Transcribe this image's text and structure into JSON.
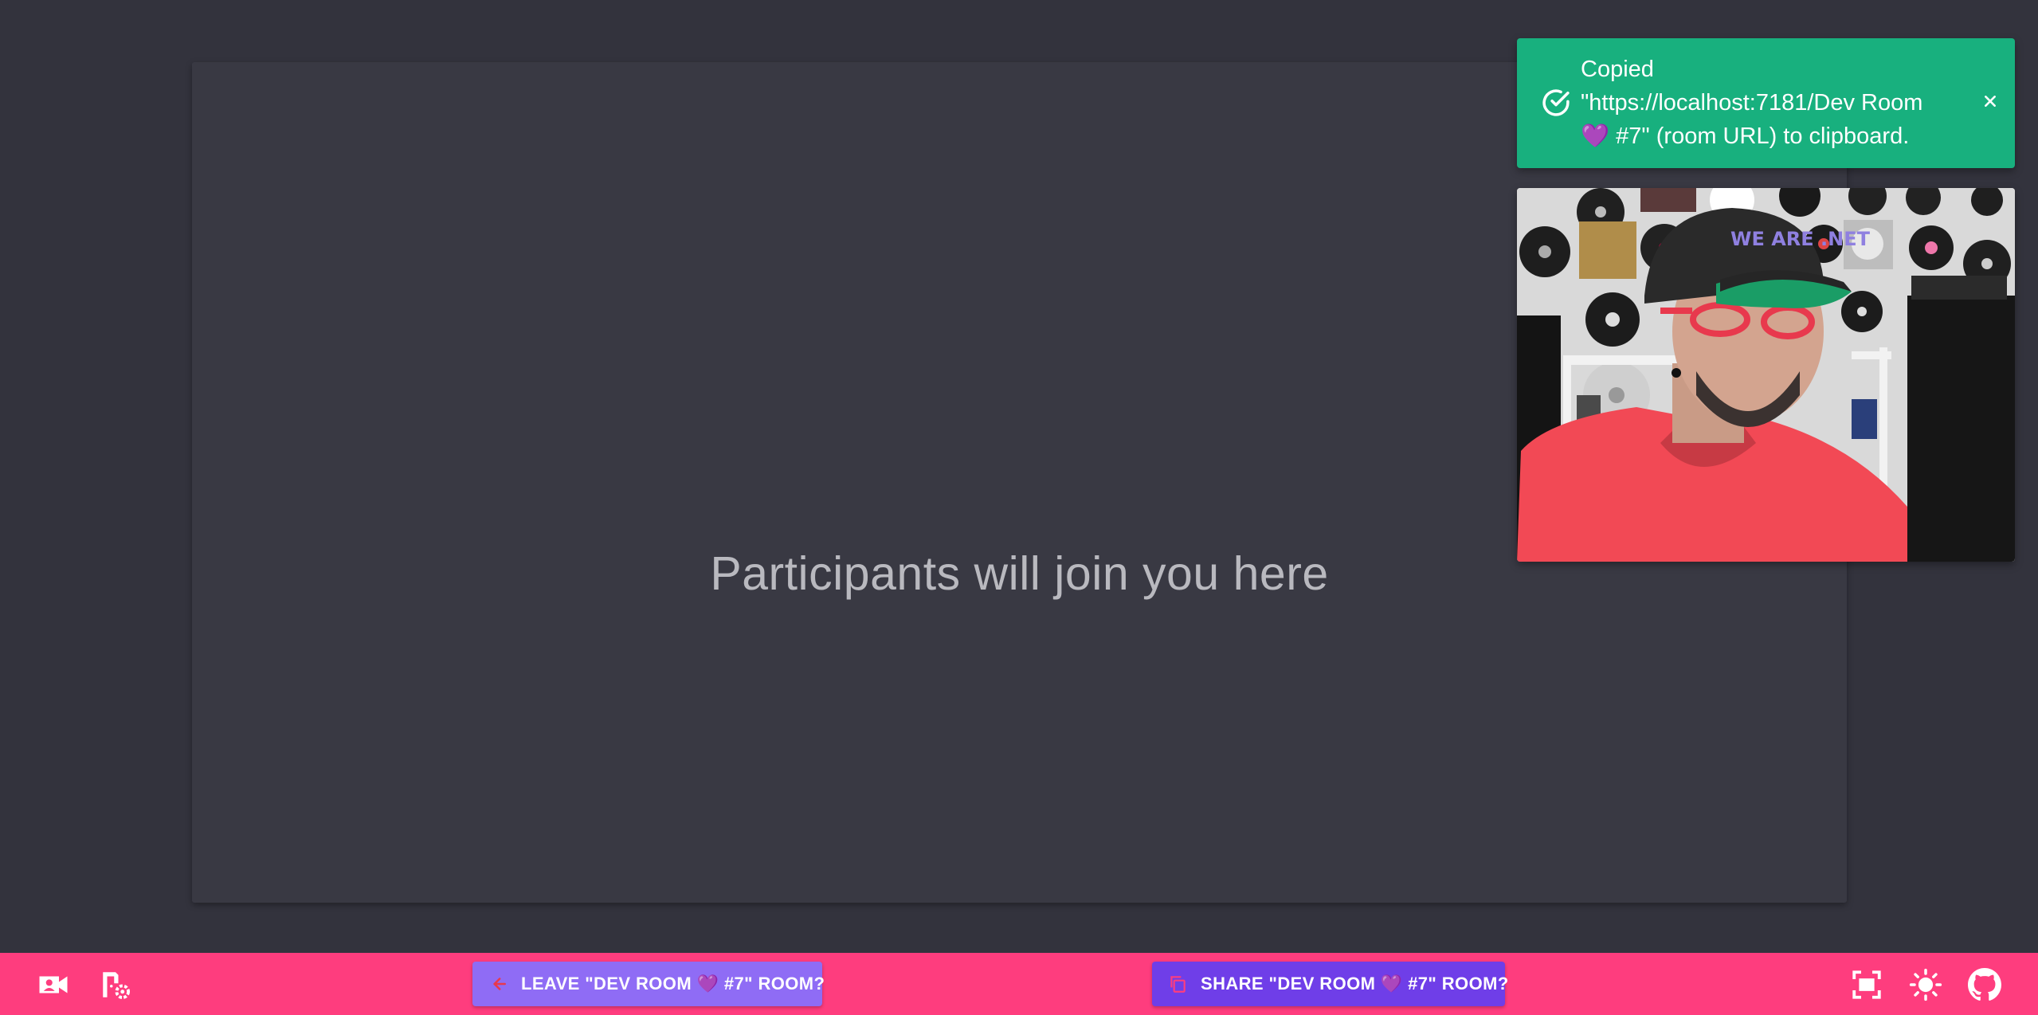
{
  "stage": {
    "placeholder": "Participants will join you here"
  },
  "toast": {
    "line1": "Copied",
    "line2": "\"https://localhost:7181/Dev Room",
    "line3": "💜 #7\" (room URL) to clipboard.",
    "status_color": "#18b07e"
  },
  "local_video": {
    "cap_text": "WE ARE .NET"
  },
  "toolbar": {
    "leave_label": "LEAVE \"DEV ROOM 💜 #7\" ROOM?",
    "share_label": "SHARE \"DEV ROOM 💜 #7\" ROOM?",
    "icons": [
      "video-camera-icon",
      "room-settings-icon",
      "fullscreen-icon",
      "theme-brightness-icon",
      "github-icon"
    ],
    "accent_color": "#fe3d7e"
  }
}
